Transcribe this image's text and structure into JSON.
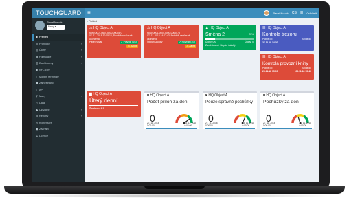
{
  "brand": "TOUCHGUARD",
  "topbar": {
    "menu_glyph": "≡",
    "user": "Pavel Novák",
    "links": [
      "CS",
      "☰",
      "Odhlásit"
    ]
  },
  "sidebar": {
    "user_name": "Pavel Novák",
    "select_value": "Firmy ▾",
    "items": [
      {
        "icon": "◈",
        "label": "Přehled",
        "active": true,
        "arrow": ""
      },
      {
        "icon": "▤",
        "label": "Prohlídky",
        "active": false,
        "arrow": "‹"
      },
      {
        "icon": "▤",
        "label": "Úlohy",
        "active": false,
        "arrow": "‹"
      },
      {
        "icon": "▦",
        "label": "Formuláře",
        "active": false,
        "arrow": "‹"
      },
      {
        "icon": "▧",
        "label": "Dashboardy",
        "active": false,
        "arrow": "‹"
      },
      {
        "icon": "◉",
        "label": "NFC čipy",
        "active": false,
        "arrow": ""
      },
      {
        "icon": "▯",
        "label": "Mobilní terminály",
        "active": false,
        "arrow": ""
      },
      {
        "icon": "☗",
        "label": "Zaměstnanci",
        "active": false,
        "arrow": ""
      },
      {
        "icon": "⌂",
        "label": "API",
        "active": false,
        "arrow": ""
      },
      {
        "icon": "⚲",
        "label": "Mapy",
        "active": false,
        "arrow": "‹"
      },
      {
        "icon": "◷",
        "label": "Data",
        "active": false,
        "arrow": ""
      },
      {
        "icon": "♟",
        "label": "Uživatelé",
        "active": false,
        "arrow": "‹"
      },
      {
        "icon": "▥",
        "label": "Reporty",
        "active": false,
        "arrow": "‹"
      },
      {
        "icon": "✎",
        "label": "Komentáře",
        "active": false,
        "arrow": ""
      },
      {
        "icon": "▣",
        "label": "Záznam",
        "active": false,
        "arrow": ""
      },
      {
        "icon": "⚿",
        "label": "Licence",
        "active": false,
        "arrow": ""
      }
    ]
  },
  "breadcrumb": "⌂  Přehled",
  "cards": {
    "c1": {
      "title": "HQ Object A",
      "lines": [
        "Nový 0001-0604-5000-0002577",
        "07. 11. 2018 10:05:12, Prohlídk nevčasně",
        "ukončena",
        "Pavel Novák"
      ],
      "status": "✓ Potvrdit (1/1)",
      "action": "⚠ Zavřít"
    },
    "c2": {
      "title": "HQ Object A",
      "lines": [
        "Nový 0001-0604-5000-0002578",
        "07. 11. 2018 14:07:43, Prohlídk nevčasně",
        "ukončena",
        "Štěpán Jakubý"
      ],
      "status": "✓ Potvrdit (1/1)",
      "action": "⚠ Zavřít"
    },
    "c3": {
      "title": "HQ Object A",
      "big": "Směna 2",
      "pct": "20%",
      "progress": 0.2,
      "left": "Úlohy: 0/0",
      "right": "Úlohy: 0",
      "person": "Zaměstnanci: Štěpán Jakubý"
    },
    "c4": {
      "title": "HQ Object A",
      "big": "Kontrola trezoru",
      "l1": "Platné od",
      "r1": "Splnit do",
      "l2": "27.11.18 14:30",
      "r2": ""
    },
    "c5": {
      "title": "HQ Object A",
      "big": "Kontrola provozní knihy",
      "l1": "Platné od",
      "r1": "Splnit do",
      "l2": "26.11.18 15:00",
      "r2": "26.11.18 15:43"
    },
    "c6": {
      "title": "HQ Object A",
      "big": "Úterý denní",
      "person": "Šereberio: A.B"
    },
    "k1": {
      "title": "HQ Object A",
      "kpi": "Počet příloh za den",
      "value": "0",
      "d1": "27. 11. 2018",
      "t1": "0:00:00",
      "d2": "28. 11. 2018",
      "t2": "0:00:00"
    },
    "k2": {
      "title": "HQ Object A",
      "kpi": "Pouze správně pochůzky",
      "value": "0",
      "d1": "27. 11. 2018",
      "t1": "0:00:00",
      "d2": "28. 11. 2018",
      "t2": "0:00:00"
    },
    "k3": {
      "title": "HQ Object A",
      "kpi": "Pochůzky za den",
      "value": "0",
      "d1": "27. 11. 2018",
      "t1": "0:00:00",
      "d2": "28. 11. 2018",
      "t2": "0:00:00"
    }
  },
  "colors": {
    "red": "#dd4b39",
    "green": "#00a65a",
    "blue": "#4a5bc0",
    "header": "#3c8dbc",
    "sidebar": "#222d32"
  },
  "icons": [
    "menu-icon",
    "avatar-icon",
    "warning-icon",
    "check-icon",
    "home-icon",
    "gauge-icon"
  ]
}
